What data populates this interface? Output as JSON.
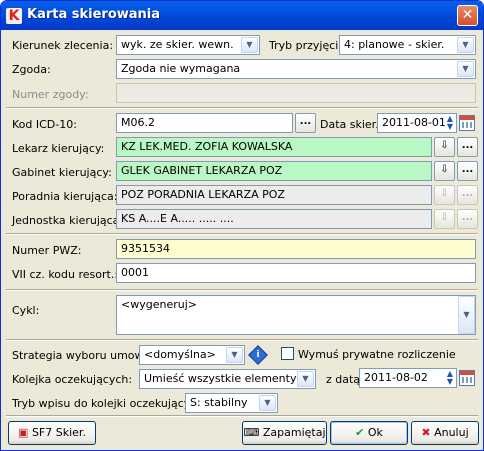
{
  "window": {
    "title": "Karta skierowania",
    "close": "✕"
  },
  "rows": {
    "kierunek": {
      "label": "Kierunek zlecenia:",
      "value": "wyk. ze skier. wewn."
    },
    "tryb": {
      "label": "Tryb przyjęcia:",
      "value": "4: planowe - skier."
    },
    "zgoda": {
      "label": "Zgoda:",
      "value": "Zgoda nie wymagana"
    },
    "numer_zgody": {
      "label": "Numer zgody:",
      "value": ""
    },
    "kod_icd": {
      "label": "Kod ICD-10:",
      "value": "M06.2",
      "btn": "..."
    },
    "data_skier": {
      "label": "Data skier.:",
      "value": "2011-08-01"
    },
    "lekarz": {
      "label": "Lekarz kierujący:",
      "value": "KZ LEK.MED. ZOFIA KOWALSKA",
      "btn": "..."
    },
    "gabinet": {
      "label": "Gabinet kierujący:",
      "value": "GLEK GABINET LEKARZA POZ",
      "btn": "..."
    },
    "poradnia": {
      "label": "Poradnia kierująca:",
      "value": "POZ PORADNIA LEKARZA POZ",
      "btn": "..."
    },
    "jednostka": {
      "label": "Jednostka kierująca:",
      "value": "KS A....E A.....   ..... ....",
      "btn": "..."
    },
    "pwz": {
      "label": "Numer PWZ:",
      "value": "9351534"
    },
    "vii": {
      "label": "VII cz. kodu resort.:",
      "value": "0001"
    },
    "cykl": {
      "label": "Cykl:",
      "value": "<wygeneruj>"
    },
    "strategia": {
      "label": "Strategia wyboru umowy:",
      "value": "<domyślna>"
    },
    "wymus": {
      "label": "Wymuś prywatne rozliczenie"
    },
    "kolejka": {
      "label": "Kolejka oczekujących:",
      "value": "Umieść wszystkie elementy"
    },
    "z_data": {
      "label": "z datą:",
      "value": "2011-08-02"
    },
    "tryb_wpisu": {
      "label": "Tryb wpisu do kolejki oczekujących:",
      "value": "S: stabilny"
    }
  },
  "buttons": {
    "sf7": "SF7 Skier.",
    "zapamietaj": "Zapamiętaj",
    "ok": "Ok",
    "anuluj": "Anuluj"
  },
  "colors": {
    "green": "#b9f8c4",
    "yellow": "#fdfdcf",
    "title": "#0246d6"
  }
}
